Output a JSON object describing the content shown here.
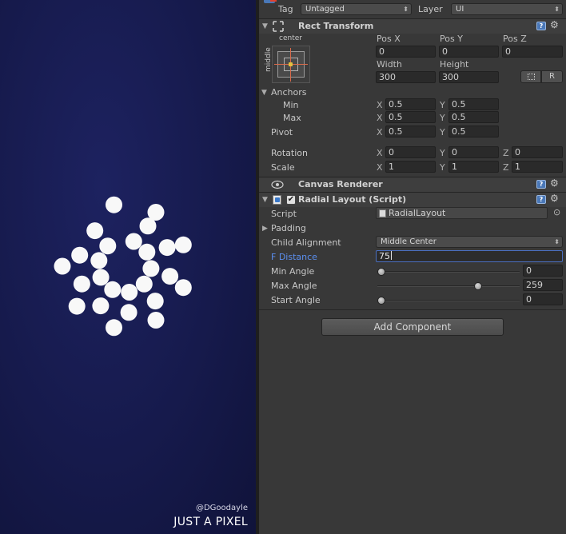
{
  "game": {
    "credit_handle": "@DGoodayle",
    "credit_brand": "JUST A PIXEL",
    "background": "#161a4c",
    "dot_color": "#f8f8f8"
  },
  "header": {
    "tag_label": "Tag",
    "tag_value": "Untagged",
    "layer_label": "Layer",
    "layer_value": "UI"
  },
  "rect_transform": {
    "title": "Rect Transform",
    "anchor_h": "center",
    "anchor_v": "middle",
    "pos_x_label": "Pos X",
    "pos_x": "0",
    "pos_y_label": "Pos Y",
    "pos_y": "0",
    "pos_z_label": "Pos Z",
    "pos_z": "0",
    "width_label": "Width",
    "width": "300",
    "height_label": "Height",
    "height": "300",
    "r_button": "R",
    "anchors_label": "Anchors",
    "min_label": "Min",
    "min_x": "0.5",
    "min_y": "0.5",
    "max_label": "Max",
    "max_x": "0.5",
    "max_y": "0.5",
    "pivot_label": "Pivot",
    "pivot_x": "0.5",
    "pivot_y": "0.5",
    "rotation_label": "Rotation",
    "rot_x": "0",
    "rot_y": "0",
    "rot_z": "0",
    "scale_label": "Scale",
    "scale_x": "1",
    "scale_y": "1",
    "scale_z": "1",
    "axis_x": "X",
    "axis_y": "Y",
    "axis_z": "Z"
  },
  "canvas_renderer": {
    "title": "Canvas Renderer"
  },
  "radial_layout": {
    "title": "Radial Layout (Script)",
    "script_label": "Script",
    "script_value": "RadialLayout",
    "padding_label": "Padding",
    "child_alignment_label": "Child Alignment",
    "child_alignment_value": "Middle Center",
    "f_distance_label": "F Distance",
    "f_distance_value": "75",
    "min_angle_label": "Min Angle",
    "min_angle": "0",
    "max_angle_label": "Max Angle",
    "max_angle": "259",
    "start_angle_label": "Start Angle",
    "start_angle": "0",
    "slider_max": 360
  },
  "add_component_label": "Add Component",
  "icons": {
    "help": "?",
    "gear": "⚙",
    "checkbox": "✔",
    "triangle_down": "▼",
    "triangle_right": "▶",
    "dropdown_arrows": "⬍",
    "target": "⊙"
  },
  "colors": {
    "inspector_bg": "#383838",
    "field_bg": "#2a2a2a",
    "highlight_label": "#5b8ff0",
    "active_border": "#4a6fc0"
  }
}
